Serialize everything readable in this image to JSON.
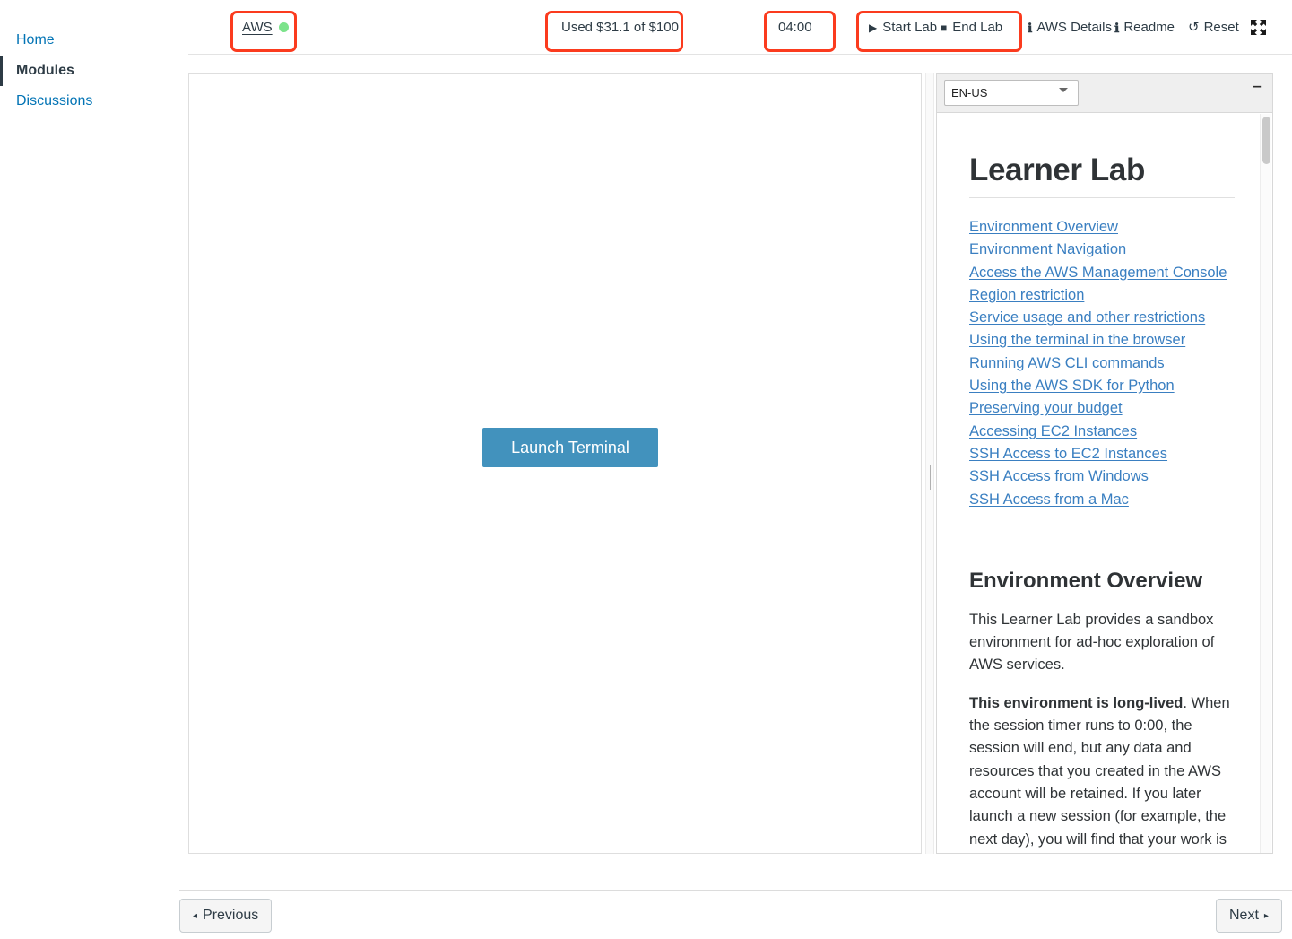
{
  "toolbar": {
    "aws_label": "AWS",
    "aws_status_color": "#7ce38b",
    "budget_used": "Used $31.1 of $100",
    "session_timer": "04:00",
    "start_lab": "Start Lab",
    "end_lab": "End Lab",
    "aws_details": "AWS Details",
    "readme": "Readme",
    "reset": "Reset",
    "play_glyph": "▶",
    "stop_glyph": "■",
    "info_glyph": "ℹ",
    "reset_glyph": "↺",
    "highlight_color": "#fb3b1e"
  },
  "course_nav": {
    "items": [
      {
        "label": "Home",
        "active": false
      },
      {
        "label": "Modules",
        "active": true
      },
      {
        "label": "Discussions",
        "active": false
      }
    ]
  },
  "terminal": {
    "launch_button": "Launch Terminal",
    "button_color": "#4292bd"
  },
  "readme_panel": {
    "language_selected": "EN-US",
    "language_options": [
      "EN-US"
    ],
    "minimize_glyph": "–",
    "title": "Learner Lab",
    "toc": [
      "Environment Overview",
      "Environment Navigation ",
      "Access the AWS Management Console ",
      "Region restriction ",
      "Service usage and other restrictions ",
      "Using the terminal in the browser ",
      "Running AWS CLI commands ",
      "Using the AWS SDK for Python ",
      "Preserving your budget ",
      "Accessing EC2 Instances ",
      "SSH Access to EC2 Instances ",
      "SSH Access from Windows",
      "SSH Access from a Mac"
    ],
    "section_heading": "Environment Overview",
    "paragraph_1": "This Learner Lab provides a sandbox environment for ad-hoc exploration of AWS services.",
    "paragraph_2_bold": "This environment is long-lived",
    "paragraph_2_rest": ". When the session timer runs to 0:00, the session will end, but any data and resources that you created in the AWS account will be retained. If you later launch a new session (for example, the next day), you will find that your work is still in the lab environment.",
    "link_color": "#3a7fc1"
  },
  "pagination": {
    "previous": "Previous",
    "next": "Next",
    "prev_arrow": "◂",
    "next_arrow": "▸"
  }
}
